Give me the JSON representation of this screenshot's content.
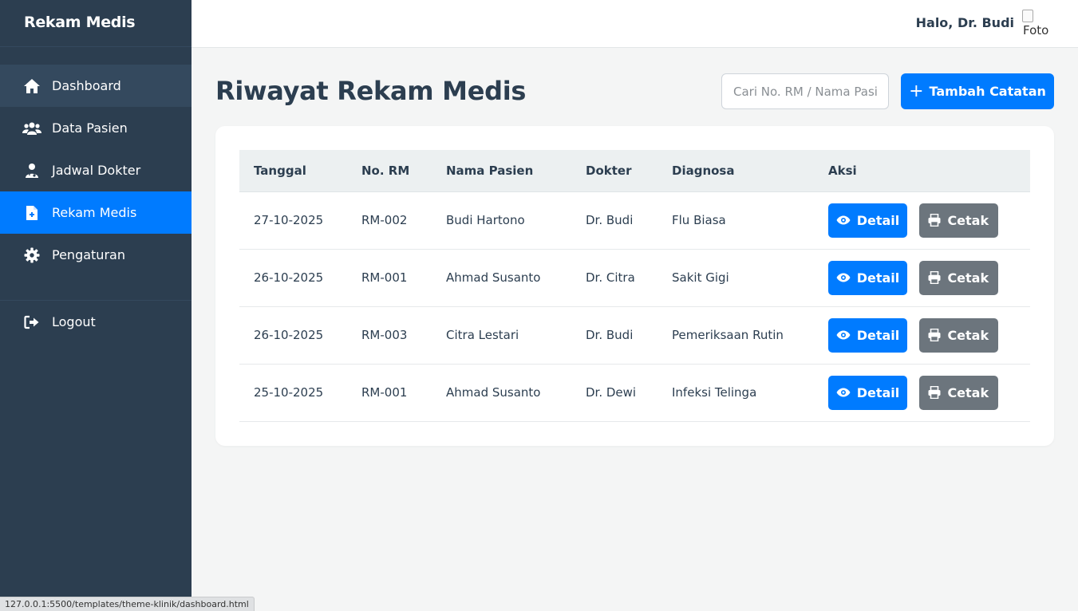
{
  "sidebar": {
    "brand": "Rekam Medis",
    "items": [
      {
        "label": "Dashboard",
        "icon": "home-icon"
      },
      {
        "label": "Data Pasien",
        "icon": "users-icon"
      },
      {
        "label": "Jadwal Dokter",
        "icon": "doctor-icon"
      },
      {
        "label": "Rekam Medis",
        "icon": "file-medical-icon"
      },
      {
        "label": "Pengaturan",
        "icon": "gear-icon"
      }
    ],
    "logout_label": "Logout"
  },
  "topbar": {
    "greeting": "Halo, Dr. Budi",
    "avatar_alt": "Foto"
  },
  "main": {
    "title": "Riwayat Rekam Medis",
    "search_placeholder": "Cari No. RM / Nama Pasien",
    "add_label": "Tambah Catatan"
  },
  "table": {
    "headers": [
      "Tanggal",
      "No. RM",
      "Nama Pasien",
      "Dokter",
      "Diagnosa",
      "Aksi"
    ],
    "rows": [
      {
        "tanggal": "27-10-2025",
        "no_rm": "RM-002",
        "nama": "Budi Hartono",
        "dokter": "Dr. Budi",
        "diagnosa": "Flu Biasa"
      },
      {
        "tanggal": "26-10-2025",
        "no_rm": "RM-001",
        "nama": "Ahmad Susanto",
        "dokter": "Dr. Citra",
        "diagnosa": "Sakit Gigi"
      },
      {
        "tanggal": "26-10-2025",
        "no_rm": "RM-003",
        "nama": "Citra Lestari",
        "dokter": "Dr. Budi",
        "diagnosa": "Pemeriksaan Rutin"
      },
      {
        "tanggal": "25-10-2025",
        "no_rm": "RM-001",
        "nama": "Ahmad Susanto",
        "dokter": "Dr. Dewi",
        "diagnosa": "Infeksi Telinga"
      }
    ],
    "detail_label": "Detail",
    "print_label": "Cetak"
  },
  "status_url": "127.0.0.1:5500/templates/theme-klinik/dashboard.html",
  "colors": {
    "sidebar_bg": "#2c3e50",
    "accent": "#007bff",
    "secondary": "#6c757d"
  }
}
